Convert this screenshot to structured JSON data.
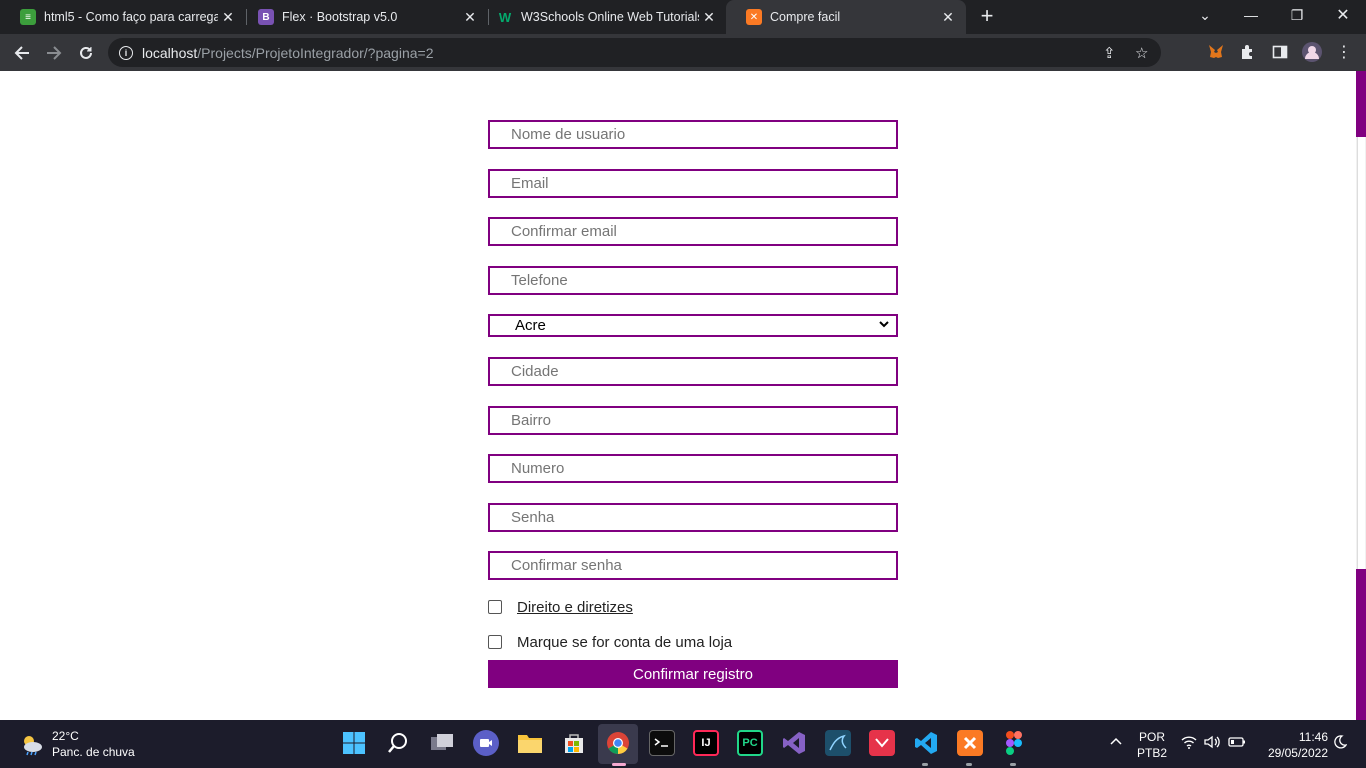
{
  "browser": {
    "tabs": [
      {
        "title": "html5 - Como faço para carregar",
        "favicon": "stackoverflow-icon",
        "color": "#3c9e3c"
      },
      {
        "title": "Flex · Bootstrap v5.0",
        "favicon": "bootstrap-icon",
        "color": "#7952b3"
      },
      {
        "title": "W3Schools Online Web Tutorials",
        "favicon": "w3schools-icon",
        "color": "#04aa6d"
      },
      {
        "title": "Compre facil",
        "favicon": "xampp-icon",
        "color": "#fb7a24"
      }
    ],
    "address": {
      "host": "localhost",
      "path": "/Projects/ProjetoIntegrador/?pagina=2"
    }
  },
  "form": {
    "username_placeholder": "Nome de usuario",
    "email_placeholder": "Email",
    "confirm_email_placeholder": "Confirmar email",
    "phone_placeholder": "Telefone",
    "state_selected": "Acre",
    "city_placeholder": "Cidade",
    "district_placeholder": "Bairro",
    "number_placeholder": "Numero",
    "password_placeholder": "Senha",
    "confirm_password_placeholder": "Confirmar senha",
    "terms_label": "Direito e diretizes",
    "store_label": "Marque se for conta de uma loja",
    "submit_label": "Confirmar registro",
    "accent_color": "#800080"
  },
  "taskbar": {
    "weather_temp": "22°C",
    "weather_desc": "Panc. de chuva",
    "lang_1": "POR",
    "lang_2": "PTB2",
    "time": "11:46",
    "date": "29/05/2022"
  }
}
